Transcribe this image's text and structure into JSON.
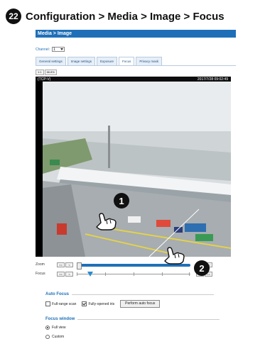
{
  "heading": {
    "step_number": "22",
    "title": "Configuration > Media > Image > Focus"
  },
  "panel": {
    "title": "Media > Image",
    "channel_label": "Channel:",
    "channel_value": "1"
  },
  "tabs": [
    {
      "label": "General settings"
    },
    {
      "label": "Image settings"
    },
    {
      "label": "Exposure"
    },
    {
      "label": "Focus",
      "active": true
    },
    {
      "label": "Privacy mask"
    }
  ],
  "video": {
    "zoom_buttons": [
      "1:1",
      "66.8%"
    ],
    "osd_left": "(TCP-V)",
    "osd_right": "2017/7/28 09:02:49"
  },
  "controls": {
    "zoom_label": "Zoom",
    "focus_label": "Focus",
    "left_buttons": [
      "<<",
      "<"
    ],
    "right_buttons": [
      ">",
      ">>"
    ],
    "zoom_level": 0.0,
    "focus_level": 0.12
  },
  "auto_focus": {
    "title": "Auto Focus",
    "full_range_scan": "Full-range scan",
    "full_range_checked": false,
    "fully_opened_iris": "Fully-opened iris",
    "fully_opened_checked": true,
    "button": "Perform auto focus"
  },
  "focus_window": {
    "title": "Focus window",
    "options": [
      {
        "label": "Full view",
        "selected": true
      },
      {
        "label": "Custom",
        "selected": false
      }
    ]
  },
  "callouts": [
    "1",
    "2"
  ],
  "icons": {
    "step_badge": "numbered-circle-icon",
    "hand": "pointing-hand-icon",
    "dropdown": "chevron-down-icon"
  },
  "colors": {
    "accent": "#1f6fb8",
    "tab_bg": "#e6eef7",
    "focus_thumb": "#2a8bd0"
  }
}
